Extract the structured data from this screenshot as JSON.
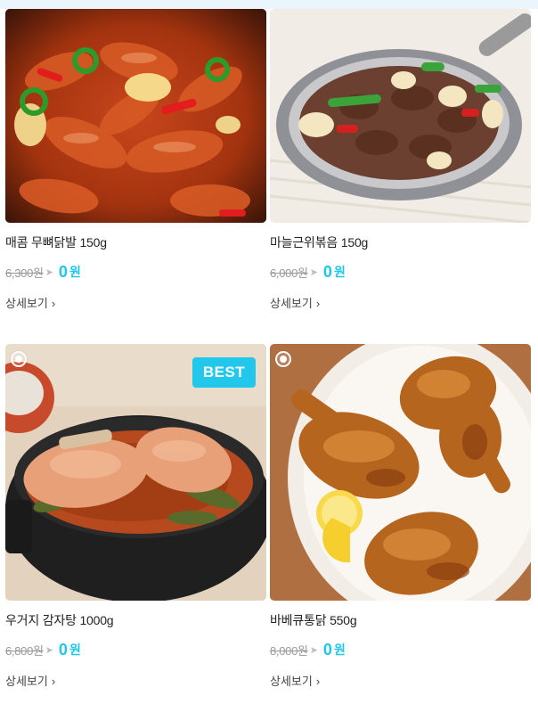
{
  "products": [
    {
      "name": "매콤 무뼈닭발 150g",
      "original_price": "6,300원",
      "sale_price": "0",
      "currency": "원",
      "detail_label": "상세보기",
      "badge": "",
      "image": "spicy-boneless-chicken-feet-photo"
    },
    {
      "name": "마늘근위볶음 150g",
      "original_price": "6,000원",
      "sale_price": "0",
      "currency": "원",
      "detail_label": "상세보기",
      "badge": "",
      "image": "garlic-gizzard-stirfry-photo"
    },
    {
      "name": "우거지 감자탕 1000g",
      "original_price": "6,800원",
      "sale_price": "0",
      "currency": "원",
      "detail_label": "상세보기",
      "badge": "BEST",
      "image": "potato-pork-bone-stew-photo"
    },
    {
      "name": "바베큐통닭 550g",
      "original_price": "8,000원",
      "sale_price": "0",
      "currency": "원",
      "detail_label": "상세보기",
      "badge": "",
      "image": "bbq-whole-chicken-photo"
    }
  ],
  "colors": {
    "accent": "#1ec7e8",
    "badge_bg": "#22c8ec",
    "strike_text": "#999999"
  }
}
